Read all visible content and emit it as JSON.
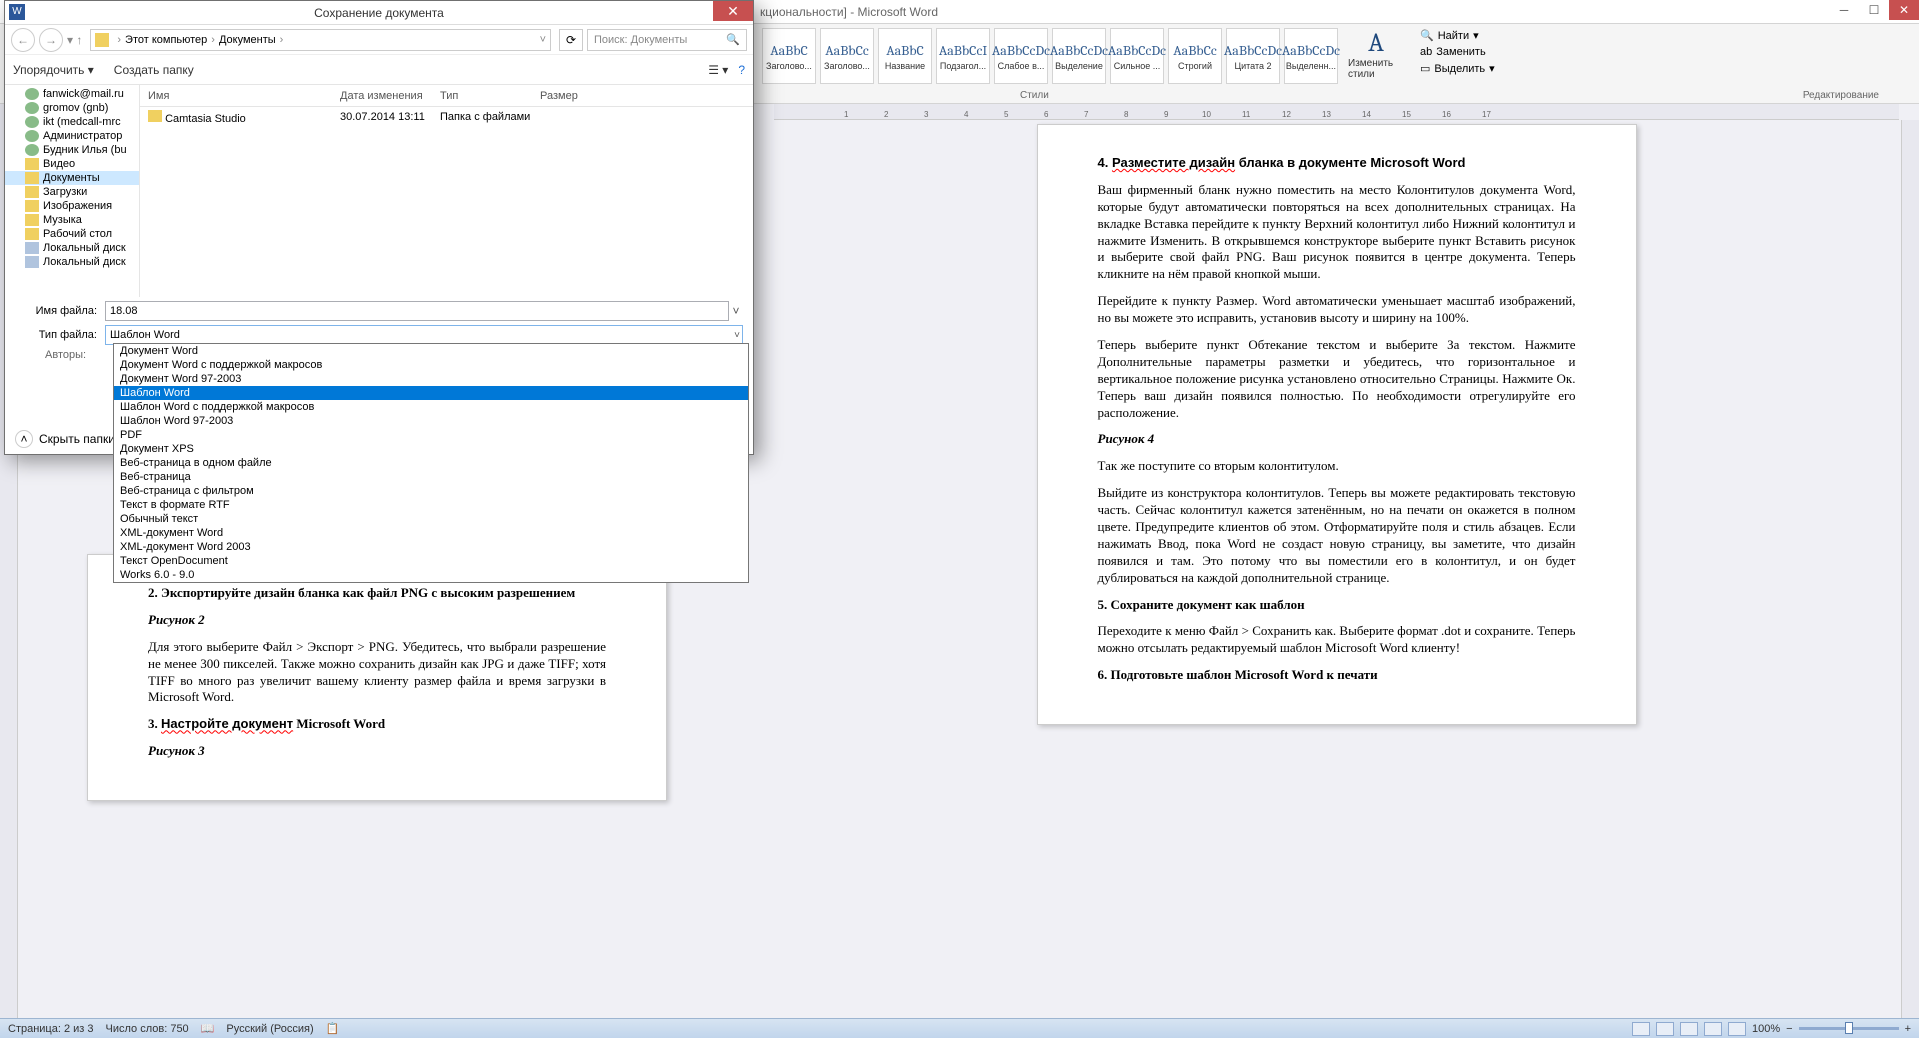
{
  "word": {
    "title": "кциональности] - Microsoft Word",
    "ribbon": {
      "styles": [
        {
          "preview": "AaBbC",
          "name": "Заголово..."
        },
        {
          "preview": "AaBbCc",
          "name": "Заголово..."
        },
        {
          "preview": "AaBbC",
          "name": "Название"
        },
        {
          "preview": "AaBbCcI",
          "name": "Подзагол..."
        },
        {
          "preview": "AaBbCcDc",
          "name": "Слабое в..."
        },
        {
          "preview": "AaBbCcDc",
          "name": "Выделение"
        },
        {
          "preview": "AaBbCcDc",
          "name": "Сильное ..."
        },
        {
          "preview": "AaBbCc",
          "name": "Строгий"
        },
        {
          "preview": "AaBbCcDc",
          "name": "Цитата 2"
        },
        {
          "preview": "AaBbCcDc",
          "name": "Выделенн..."
        }
      ],
      "styles_label": "Стили",
      "change_styles": "Изменить стили",
      "edit_find": "Найти",
      "edit_replace": "Заменить",
      "edit_select": "Выделить",
      "edit_label": "Редактирование"
    }
  },
  "doc_left": {
    "h2": "2. Экспортируйте дизайн бланка как файл PNG с высоким разрешением",
    "fig2": "Рисунок 2",
    "p2": "Для этого выберите Файл > Экспорт > PNG. Убедитесь, что выбрали разрешение не менее 300 пикселей. Также можно сохранить дизайн как JPG и даже TIFF; хотя TIFF во много раз увеличит вашему клиенту размер файла и время загрузки в Microsoft Word.",
    "h3": "3. Настройте документ Microsoft Word",
    "fig3": "Рисунок 3"
  },
  "doc_right": {
    "h4": "4. Разместите дизайн бланка в документе Microsoft Word",
    "p4a": "Ваш фирменный бланк нужно поместить на место Колонтитулов документа Word, которые будут автоматически повторяться на всех дополнительных страницах. На вкладке Вставка перейдите к пункту Верхний колонтитул либо Нижний колонтитул и нажмите Изменить. В открывшемся конструкторе выберите пункт Вставить рисунок и выберите свой файл PNG. Ваш рисунок появится в центре документа. Теперь кликните на нём правой кнопкой мыши.",
    "p4b": "Перейдите к пункту Размер. Word автоматически уменьшает масштаб изображений, но вы можете это исправить, установив высоту и ширину на 100%.",
    "p4c": "Теперь выберите пункт Обтекание текстом и выберите За текстом. Нажмите Дополнительные параметры разметки и убедитесь, что горизонтальное и вертикальное положение рисунка установлено относительно Страницы. Нажмите Ок. Теперь ваш дизайн появился полностью. По необходимости отрегулируйте его расположение.",
    "fig4": "Рисунок 4",
    "p4d": "Так же поступите со вторым колонтитулом.",
    "p4e": "Выйдите из конструктора колонтитулов. Теперь вы можете редактировать текстовую часть. Сейчас колонтитул кажется затенённым, но на печати он окажется в полном цвете. Предупредите клиентов об этом. Отформатируйте поля и стиль абзацев. Если нажимать Ввод, пока Word не создаст новую страницу, вы заметите, что дизайн появился и там. Это потому что вы поместили его в колонтитул, и он будет дублироваться на каждой дополнительной странице.",
    "h5": "5. Сохраните документ как шаблон",
    "p5": "Переходите к меню Файл > Сохранить как. Выберите формат .dot и сохраните. Теперь можно отсылать редактируемый шаблон Microsoft Word клиенту!",
    "h6": "6. Подготовьте шаблон Microsoft Word к печати"
  },
  "statusbar": {
    "page": "Страница: 2 из 3",
    "words": "Число слов: 750",
    "lang": "Русский (Россия)",
    "zoom": "100%"
  },
  "dialog": {
    "title": "Сохранение документа",
    "breadcrumb": {
      "pc": "Этот компьютер",
      "docs": "Документы"
    },
    "search_placeholder": "Поиск: Документы",
    "organize": "Упорядочить",
    "new_folder": "Создать папку",
    "tree": [
      {
        "label": "fanwick@mail.ru",
        "icon": "user"
      },
      {
        "label": "gromov (gnb)",
        "icon": "user"
      },
      {
        "label": "ikt (medcall-mrc",
        "icon": "user"
      },
      {
        "label": "Администратор",
        "icon": "user"
      },
      {
        "label": "Будник Илья (bu",
        "icon": "user"
      },
      {
        "label": "Видео",
        "icon": "folder"
      },
      {
        "label": "Документы",
        "icon": "folder",
        "selected": true
      },
      {
        "label": "Загрузки",
        "icon": "folder"
      },
      {
        "label": "Изображения",
        "icon": "folder"
      },
      {
        "label": "Музыка",
        "icon": "folder"
      },
      {
        "label": "Рабочий стол",
        "icon": "folder"
      },
      {
        "label": "Локальный диск",
        "icon": "drive"
      },
      {
        "label": "Локальный диск",
        "icon": "drive"
      }
    ],
    "columns": {
      "name": "Имя",
      "date": "Дата изменения",
      "type": "Тип",
      "size": "Размер"
    },
    "file_row": {
      "name": "Camtasia Studio",
      "date": "30.07.2014 13:11",
      "type": "Папка с файлами"
    },
    "filename_label": "Имя файла:",
    "filename_value": "18.08",
    "filetype_label": "Тип файла:",
    "filetype_value": "Шаблон Word",
    "authors_label": "Авторы:",
    "hide_folders": "Скрыть папки",
    "dropdown_items": [
      "Документ Word",
      "Документ Word с поддержкой макросов",
      "Документ Word 97-2003",
      "Шаблон Word",
      "Шаблон Word с поддержкой макросов",
      "Шаблон Word 97-2003",
      "PDF",
      "Документ XPS",
      "Веб-страница в одном файле",
      "Веб-страница",
      "Веб-страница с фильтром",
      "Текст в формате RTF",
      "Обычный текст",
      "XML-документ Word",
      "XML-документ Word 2003",
      "Текст OpenDocument",
      "Works 6.0 - 9.0"
    ],
    "dropdown_selected": 3
  }
}
